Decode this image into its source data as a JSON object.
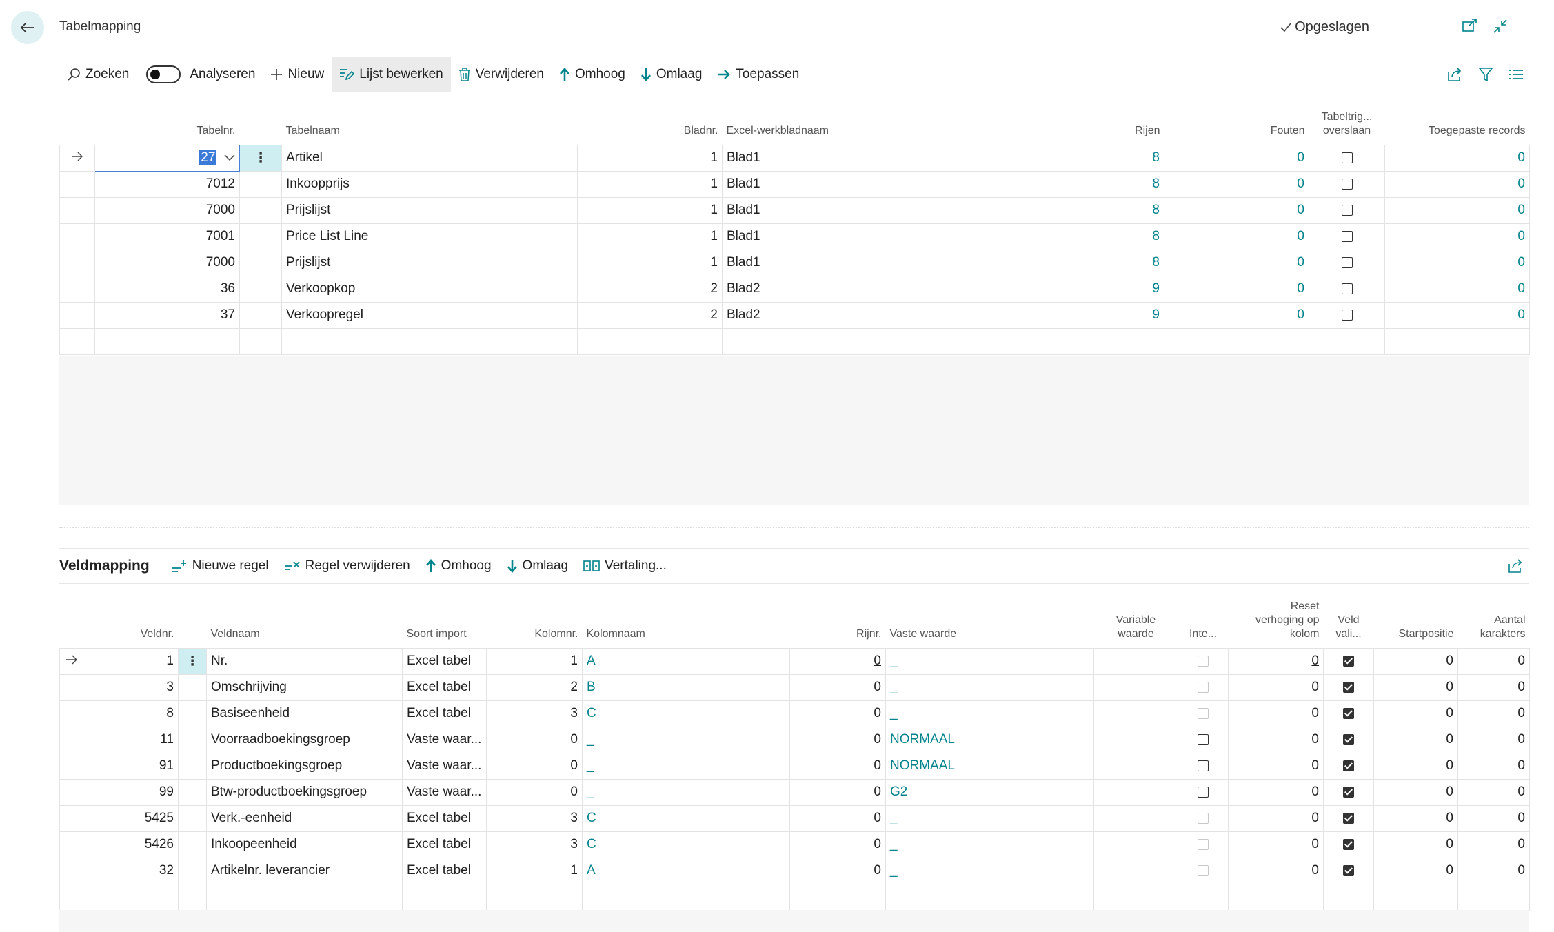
{
  "page": {
    "title": "Tabelmapping",
    "saved_label": "Opgeslagen"
  },
  "toolbar": {
    "search": "Zoeken",
    "analyze": "Analyseren",
    "new": "Nieuw",
    "edit_list": "Lijst bewerken",
    "delete": "Verwijderen",
    "up": "Omhoog",
    "down": "Omlaag",
    "apply": "Toepassen"
  },
  "table": {
    "headers": {
      "tabelnr": "Tabelnr.",
      "tabelnaam": "Tabelnaam",
      "bladnr": "Bladnr.",
      "werkbladnaam": "Excel-werkbladnaam",
      "rijen": "Rijen",
      "fouten": "Fouten",
      "trigger1": "Tabeltrig...",
      "trigger2": "overslaan",
      "toegepast": "Toegepaste records"
    },
    "rows": [
      {
        "nr": "27",
        "naam": "Artikel",
        "blad": "1",
        "werkblad": "Blad1",
        "rijen": "8",
        "fouten": "0",
        "toegepast": "0"
      },
      {
        "nr": "7012",
        "naam": "Inkoopprijs",
        "blad": "1",
        "werkblad": "Blad1",
        "rijen": "8",
        "fouten": "0",
        "toegepast": "0"
      },
      {
        "nr": "7000",
        "naam": "Prijslijst",
        "blad": "1",
        "werkblad": "Blad1",
        "rijen": "8",
        "fouten": "0",
        "toegepast": "0"
      },
      {
        "nr": "7001",
        "naam": "Price List Line",
        "blad": "1",
        "werkblad": "Blad1",
        "rijen": "8",
        "fouten": "0",
        "toegepast": "0"
      },
      {
        "nr": "7000",
        "naam": "Prijslijst",
        "blad": "1",
        "werkblad": "Blad1",
        "rijen": "8",
        "fouten": "0",
        "toegepast": "0"
      },
      {
        "nr": "36",
        "naam": "Verkoopkop",
        "blad": "2",
        "werkblad": "Blad2",
        "rijen": "9",
        "fouten": "0",
        "toegepast": "0"
      },
      {
        "nr": "37",
        "naam": "Verkoopregel",
        "blad": "2",
        "werkblad": "Blad2",
        "rijen": "9",
        "fouten": "0",
        "toegepast": "0"
      }
    ]
  },
  "subpage": {
    "title": "Veldmapping",
    "actions": {
      "new_line": "Nieuwe regel",
      "delete_line": "Regel verwijderen",
      "up": "Omhoog",
      "down": "Omlaag",
      "translation": "Vertaling..."
    },
    "headers": {
      "veldnr": "Veldnr.",
      "veldnaam": "Veldnaam",
      "soort": "Soort import",
      "kolomnr": "Kolomnr.",
      "kolomnaam": "Kolomnaam",
      "rijnr": "Rijnr.",
      "vaste": "Vaste waarde",
      "variabele1": "Variable",
      "variabele2": "waarde",
      "inte": "Inte...",
      "reset1": "Reset",
      "reset2": "verhoging op",
      "reset3": "kolom",
      "veldvali1": "Veld",
      "veldvali2": "vali...",
      "start": "Startpositie",
      "aantal1": "Aantal",
      "aantal2": "karakters"
    },
    "rows": [
      {
        "nr": "1",
        "naam": "Nr.",
        "soort": "Excel tabel",
        "kolomnr": "1",
        "kolomnaam": "A",
        "rijnr": "0",
        "vaste": "_",
        "reset": "0",
        "start": "0",
        "aantal": "0"
      },
      {
        "nr": "3",
        "naam": "Omschrijving",
        "soort": "Excel tabel",
        "kolomnr": "2",
        "kolomnaam": "B",
        "rijnr": "0",
        "vaste": "_",
        "reset": "0",
        "start": "0",
        "aantal": "0"
      },
      {
        "nr": "8",
        "naam": "Basiseenheid",
        "soort": "Excel tabel",
        "kolomnr": "3",
        "kolomnaam": "C",
        "rijnr": "0",
        "vaste": "_",
        "reset": "0",
        "start": "0",
        "aantal": "0"
      },
      {
        "nr": "11",
        "naam": "Voorraadboekingsgroep",
        "soort": "Vaste waar...",
        "kolomnr": "0",
        "kolomnaam": "_",
        "rijnr": "0",
        "vaste": "NORMAAL",
        "reset": "0",
        "start": "0",
        "aantal": "0"
      },
      {
        "nr": "91",
        "naam": "Productboekingsgroep",
        "soort": "Vaste waar...",
        "kolomnr": "0",
        "kolomnaam": "_",
        "rijnr": "0",
        "vaste": "NORMAAL",
        "reset": "0",
        "start": "0",
        "aantal": "0"
      },
      {
        "nr": "99",
        "naam": "Btw-productboekingsgroep",
        "soort": "Vaste waar...",
        "kolomnr": "0",
        "kolomnaam": "_",
        "rijnr": "0",
        "vaste": "G2",
        "reset": "0",
        "start": "0",
        "aantal": "0"
      },
      {
        "nr": "5425",
        "naam": "Verk.-eenheid",
        "soort": "Excel tabel",
        "kolomnr": "3",
        "kolomnaam": "C",
        "rijnr": "0",
        "vaste": "_",
        "reset": "0",
        "start": "0",
        "aantal": "0"
      },
      {
        "nr": "5426",
        "naam": "Inkoopeenheid",
        "soort": "Excel tabel",
        "kolomnr": "3",
        "kolomnaam": "C",
        "rijnr": "0",
        "vaste": "_",
        "reset": "0",
        "start": "0",
        "aantal": "0"
      },
      {
        "nr": "32",
        "naam": "Artikelnr. leverancier",
        "soort": "Excel tabel",
        "kolomnr": "1",
        "kolomnaam": "A",
        "rijnr": "0",
        "vaste": "_",
        "reset": "0",
        "start": "0",
        "aantal": "0"
      }
    ]
  },
  "colors": {
    "accent": "#00848c",
    "selection": "#3c7ad8"
  },
  "icons": [
    "back-arrow-icon",
    "checkmark-icon",
    "open-new-window-icon",
    "collapse-icon",
    "search-icon",
    "new-plus-icon",
    "edit-list-icon",
    "trash-icon",
    "arrow-up-icon",
    "arrow-down-icon",
    "apply-arrow-icon",
    "share-icon",
    "filter-icon",
    "list-view-icon"
  ]
}
